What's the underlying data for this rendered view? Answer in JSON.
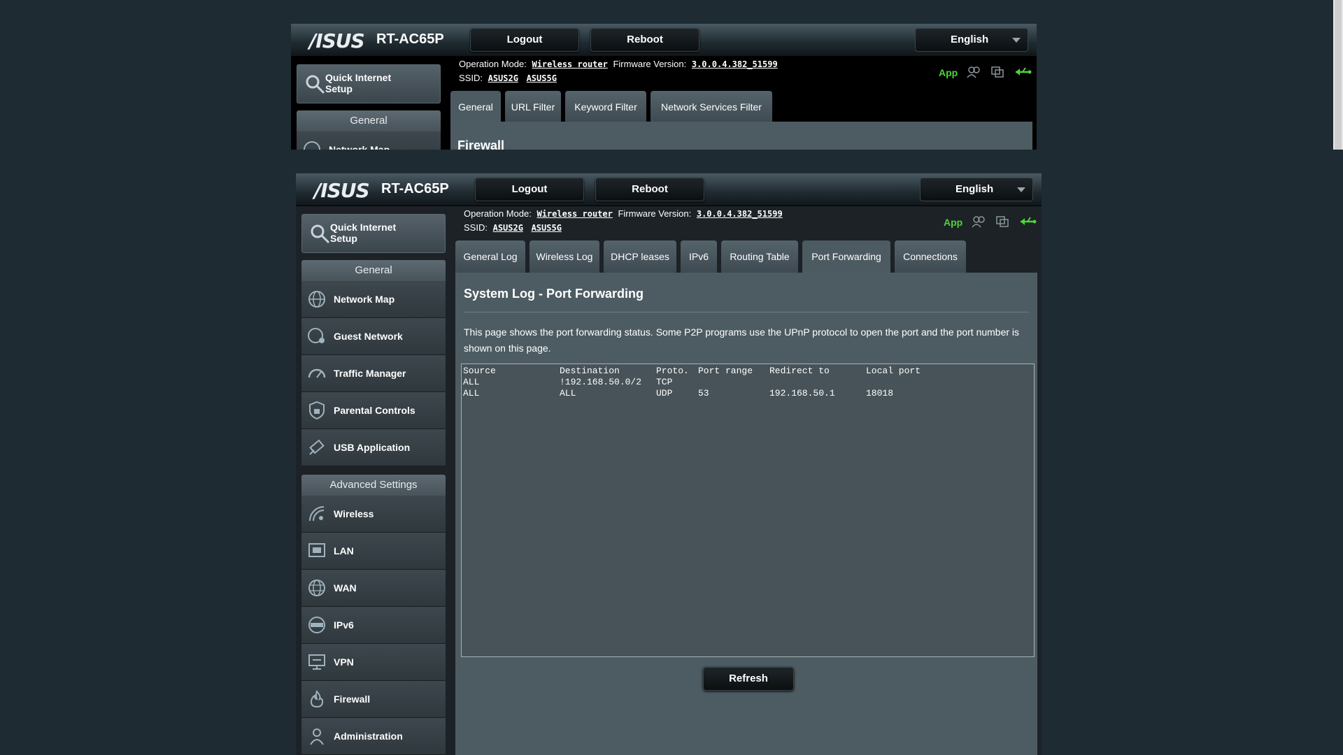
{
  "header": {
    "brand": "/ISUS",
    "model": "RT-AC65P",
    "logout_label": "Logout",
    "reboot_label": "Reboot",
    "language": "English"
  },
  "info": {
    "operation_mode_label": "Operation Mode:",
    "operation_mode_value": "Wireless router",
    "firmware_label": "Firmware Version:",
    "firmware_value": "3.0.0.4.382_51599",
    "ssid_label": "SSID:",
    "ssid_values": [
      "ASUS2G",
      "ASUS5G"
    ],
    "app_label": "App"
  },
  "top_panel": {
    "tabs": [
      "General",
      "URL Filter",
      "Keyword Filter",
      "Network Services Filter"
    ],
    "peek_title": "Firewall",
    "sidebar_group": "General",
    "sidebar_peek_item": "Network Map"
  },
  "sidebar": {
    "quick_setup": "Quick Internet Setup",
    "general_title": "General",
    "general_items": [
      "Network Map",
      "Guest Network",
      "Traffic Manager",
      "Parental Controls",
      "USB Application"
    ],
    "advanced_title": "Advanced Settings",
    "advanced_items": [
      "Wireless",
      "LAN",
      "WAN",
      "IPv6",
      "VPN",
      "Firewall",
      "Administration"
    ]
  },
  "tabs": [
    "General Log",
    "Wireless Log",
    "DHCP leases",
    "IPv6",
    "Routing Table",
    "Port Forwarding",
    "Connections"
  ],
  "active_tab": "Port Forwarding",
  "page": {
    "title": "System Log - Port Forwarding",
    "description": "This page shows the port forwarding status. Some P2P programs use the UPnP protocol to open the port and the port number is shown on this page.",
    "refresh_label": "Refresh"
  },
  "log": {
    "headers": [
      "Source",
      "Destination",
      "Proto.",
      "Port range",
      "Redirect to",
      "Local port"
    ],
    "rows": [
      [
        "ALL",
        "!192.168.50.0/2",
        "TCP",
        "",
        "",
        ""
      ],
      [
        "ALL",
        "ALL",
        "UDP",
        "53",
        "192.168.50.1",
        "18018"
      ]
    ]
  }
}
